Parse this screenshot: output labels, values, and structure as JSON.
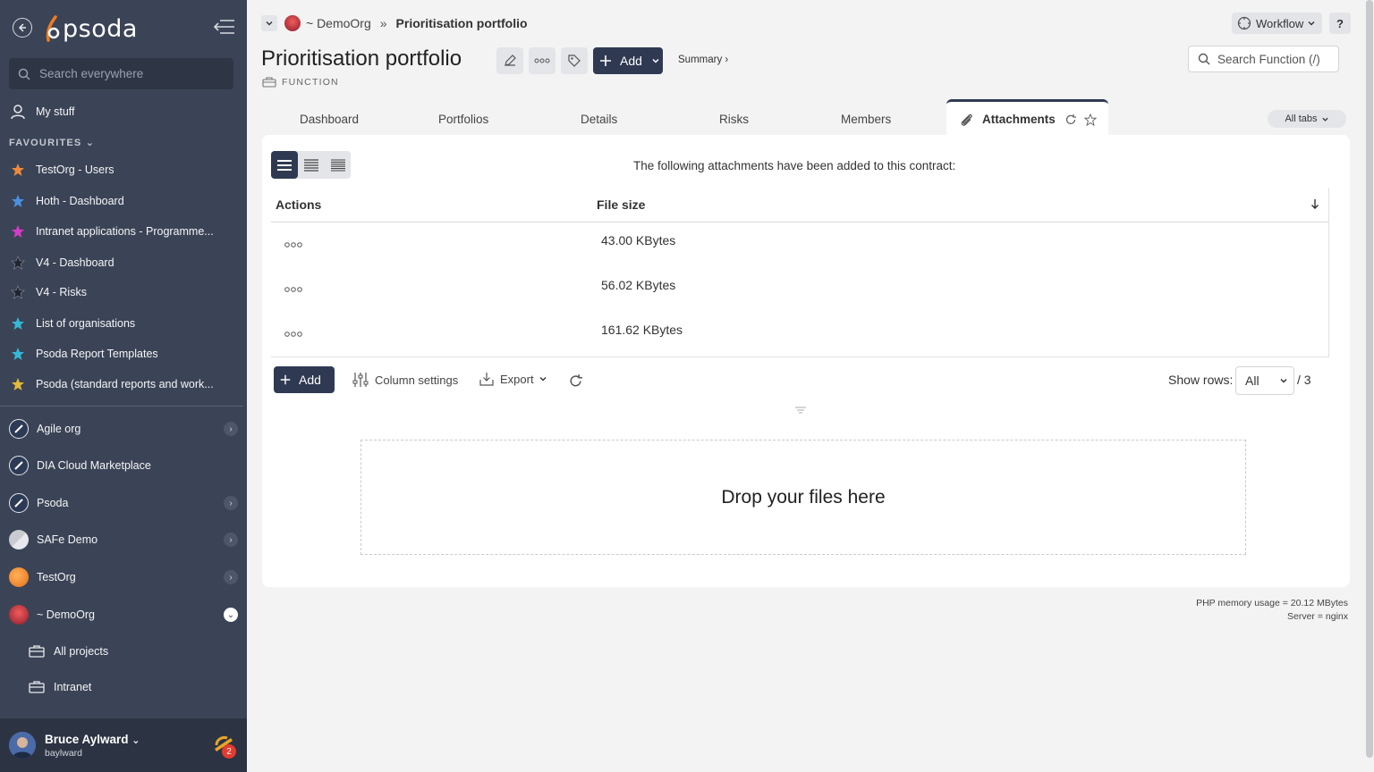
{
  "sidebar": {
    "brand": "psoda",
    "search_placeholder": "Search everywhere",
    "my_stuff": "My stuff",
    "favourites_header": "FAVOURITES",
    "favourites": [
      {
        "label": "TestOrg - Users",
        "color": "#f08a3c"
      },
      {
        "label": "Hoth - Dashboard",
        "color": "#4a90e2"
      },
      {
        "label": "Intranet applications - Programme...",
        "color": "#d63bc7"
      },
      {
        "label": "V4 - Dashboard",
        "color": "#2b2b2b"
      },
      {
        "label": "V4 - Risks",
        "color": "#2b2b2b"
      },
      {
        "label": "List of organisations",
        "color": "#35b8d6"
      },
      {
        "label": "Psoda Report Templates",
        "color": "#35b8d6"
      },
      {
        "label": "Psoda (standard reports and work...",
        "color": "#e6b838"
      }
    ],
    "orgs": [
      {
        "label": "Agile org"
      },
      {
        "label": "DIA Cloud Marketplace"
      },
      {
        "label": "Psoda"
      },
      {
        "label": "SAFe Demo"
      },
      {
        "label": "TestOrg"
      },
      {
        "label": "~ DemoOrg"
      }
    ],
    "sub_items": [
      {
        "label": "All projects"
      },
      {
        "label": "Intranet"
      }
    ],
    "user": {
      "name": "Bruce Aylward",
      "login": "baylward",
      "notifications": "2"
    }
  },
  "header": {
    "breadcrumb_org": "~ DemoOrg",
    "breadcrumb_sep": "»",
    "breadcrumb_current": "Prioritisation portfolio",
    "workflow_label": "Workflow",
    "help_label": "?",
    "title": "Prioritisation portfolio",
    "type_label": "FUNCTION",
    "add_label": "Add",
    "summary_label": "Summary ›",
    "search_placeholder": "Search Function (/)"
  },
  "tabs": {
    "items": [
      "Dashboard",
      "Portfolios",
      "Details",
      "Risks",
      "Members"
    ],
    "active": "Attachments",
    "all_tabs": "All tabs"
  },
  "attachments": {
    "intro": "The following attachments have been added to this contract:",
    "columns": [
      "Actions",
      "File size"
    ],
    "rows": [
      {
        "actions": "ooo",
        "size": "43.00 KBytes"
      },
      {
        "actions": "ooo",
        "size": "56.02 KBytes"
      },
      {
        "actions": "ooo",
        "size": "161.62 KBytes"
      }
    ],
    "add_label": "Add",
    "column_settings": "Column settings",
    "export": "Export",
    "show_rows_label": "Show rows:",
    "show_rows_value": "All",
    "total": "/ 3",
    "drop_text": "Drop your files here"
  },
  "footer": {
    "memory": "PHP memory usage = 20.12 MBytes",
    "server": "Server = nginx"
  },
  "colors": {
    "sidebar_bg": "#3b4456",
    "accent_dark": "#2f3a52",
    "brand_orange": "#f07d1e"
  }
}
